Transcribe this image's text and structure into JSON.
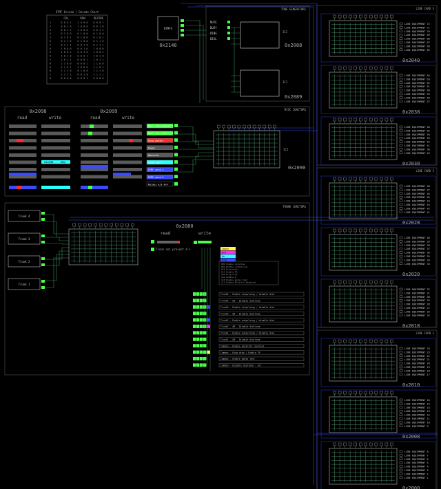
{
  "dtmf": {
    "title": "DTMF Encode / Decode Chart",
    "headers": [
      "COL",
      "ROW",
      "DECODE"
    ],
    "rows": [
      [
        "1",
        "0 0 0 1",
        "1 0 0 0",
        "0 0 0 1"
      ],
      [
        "2",
        "0 0 1 0",
        "1 0 0 0",
        "0 0 1 0"
      ],
      [
        "3",
        "0 0 1 1",
        "1 0 0 0",
        "0 0 1 1"
      ],
      [
        "4",
        "0 1 0 0",
        "0 1 0 0",
        "0 1 0 0"
      ],
      [
        "5",
        "0 1 0 1",
        "0 1 0 0",
        "0 1 0 1"
      ],
      [
        "6",
        "0 1 1 0",
        "0 1 0 0",
        "0 1 1 0"
      ],
      [
        "7",
        "0 1 1 1",
        "0 0 1 0",
        "0 1 1 1"
      ],
      [
        "8",
        "1 0 0 0",
        "0 0 1 0",
        "1 0 0 0"
      ],
      [
        "9",
        "1 0 0 1",
        "0 0 1 0",
        "1 0 0 1"
      ],
      [
        "0",
        "1 0 1 0",
        "0 0 0 1",
        "1 0 1 0"
      ],
      [
        "*",
        "1 0 1 1",
        "0 0 0 1",
        "1 0 1 1"
      ],
      [
        "#",
        "1 1 0 0",
        "0 0 0 1",
        "1 1 0 0"
      ],
      [
        "A",
        "1 1 0 1",
        "1 0 0 0",
        "1 1 0 1"
      ],
      [
        "B",
        "1 1 1 0",
        "0 1 0 0",
        "1 1 1 0"
      ],
      [
        "C",
        "1 1 1 1",
        "0 0 1 0",
        "1 1 1 1"
      ],
      [
        "D",
        "0 0 0 0",
        "0 0 0 1",
        "0 0 0 0"
      ]
    ]
  },
  "dtmf_chip": {
    "label": "DTMFS",
    "address": "0x2148"
  },
  "tone_generators": {
    "title": "TONE GENERATORS",
    "address_a": "0x2088",
    "address_b": "0x2089",
    "inputs": [
      "MUTE",
      "BUSY",
      "RING",
      "DIAL"
    ],
    "chip_a": "ICI",
    "chip_b": "ICI"
  },
  "misc_junctors": {
    "title": "MISC JUNCTORS",
    "addr_left": "0x2098",
    "addr_right": "0x2099",
    "col_read": "read",
    "col_write": "write",
    "address_grid": "0x2090",
    "buttons": [
      "Dial tone detect 1",
      "Dial tone detect 2",
      "Ring detect",
      "Power",
      "Operator",
      "Steel gun",
      "DTMF encd 1",
      "DTMF encd 2",
      "Relays 4/3 4/4"
    ],
    "read_labels": [
      "COLUMN",
      "ROW"
    ],
    "ic_label": "ICI"
  },
  "trunk_junctors": {
    "title": "TRUNK JUNCTORS",
    "address": "0x2080",
    "col_read": "read",
    "col_write": "write",
    "trunks": [
      "Trunk 4",
      "Trunk 3",
      "Trunk 2",
      "Trunk 1"
    ],
    "status": [
      "",
      "Trunk not present 4-1"
    ],
    "legend": [
      "Input",
      "Off",
      "On",
      "Line"
    ],
    "notes": [
      "000 Enable dialtone",
      "001 Enable outpulsing",
      "010 Disconnect",
      "011 Enable TR",
      "100 Ring drop",
      "101 Enable P",
      "110 Enable gates test",
      "111 Enable Polarity Reversal"
    ],
    "rows": [
      "Trunk4 - Enable outpulsing / disable dial",
      "Trunk4 - AB - Disable dialtone",
      "Trunk3 - Enable outpulsing / disable dial",
      "Trunk3 - AB - Disable dialtone",
      "Trunk2 - Enable outpulsing / disable dial",
      "Trunk2 - AB - Disable dialtone",
      "Trunk1 - Enable outpulsing / disable dial",
      "Trunk1 - AB - Disable dialtone",
      "Common - Enable polarity reversal",
      "Common - Ring drop / Enable TR",
      "Common - Enable gates test",
      "Common - Disable dialtone - all"
    ]
  },
  "line_cards": [
    {
      "title": "LINE CARD 3",
      "panels": [
        {
          "address": "0x2040",
          "start": 72
        },
        {
          "address": "0x2038",
          "start": 64
        },
        {
          "address": "0x2030",
          "start": 56
        }
      ]
    },
    {
      "title": "LINE CARD 2",
      "panels": [
        {
          "address": "0x2028",
          "start": 48
        },
        {
          "address": "0x2020",
          "start": 40
        },
        {
          "address": "0x2018",
          "start": 32
        }
      ]
    },
    {
      "title": "LINE CARD 1",
      "panels": [
        {
          "address": "0x2010",
          "start": 24
        },
        {
          "address": "0x2008",
          "start": 16
        },
        {
          "address": "0x2000",
          "start": 8
        }
      ]
    }
  ],
  "line_prefix": "LINE EQUIPMENT",
  "colors": {
    "green": "#4aff4a",
    "grid": "#4a8a6a",
    "blue": "#3a4aff",
    "cyan": "#2affff",
    "red": "#ff2a2a",
    "magenta": "#ff2aff",
    "yellow": "#ffff2a",
    "gray": "#5a5a5a"
  }
}
